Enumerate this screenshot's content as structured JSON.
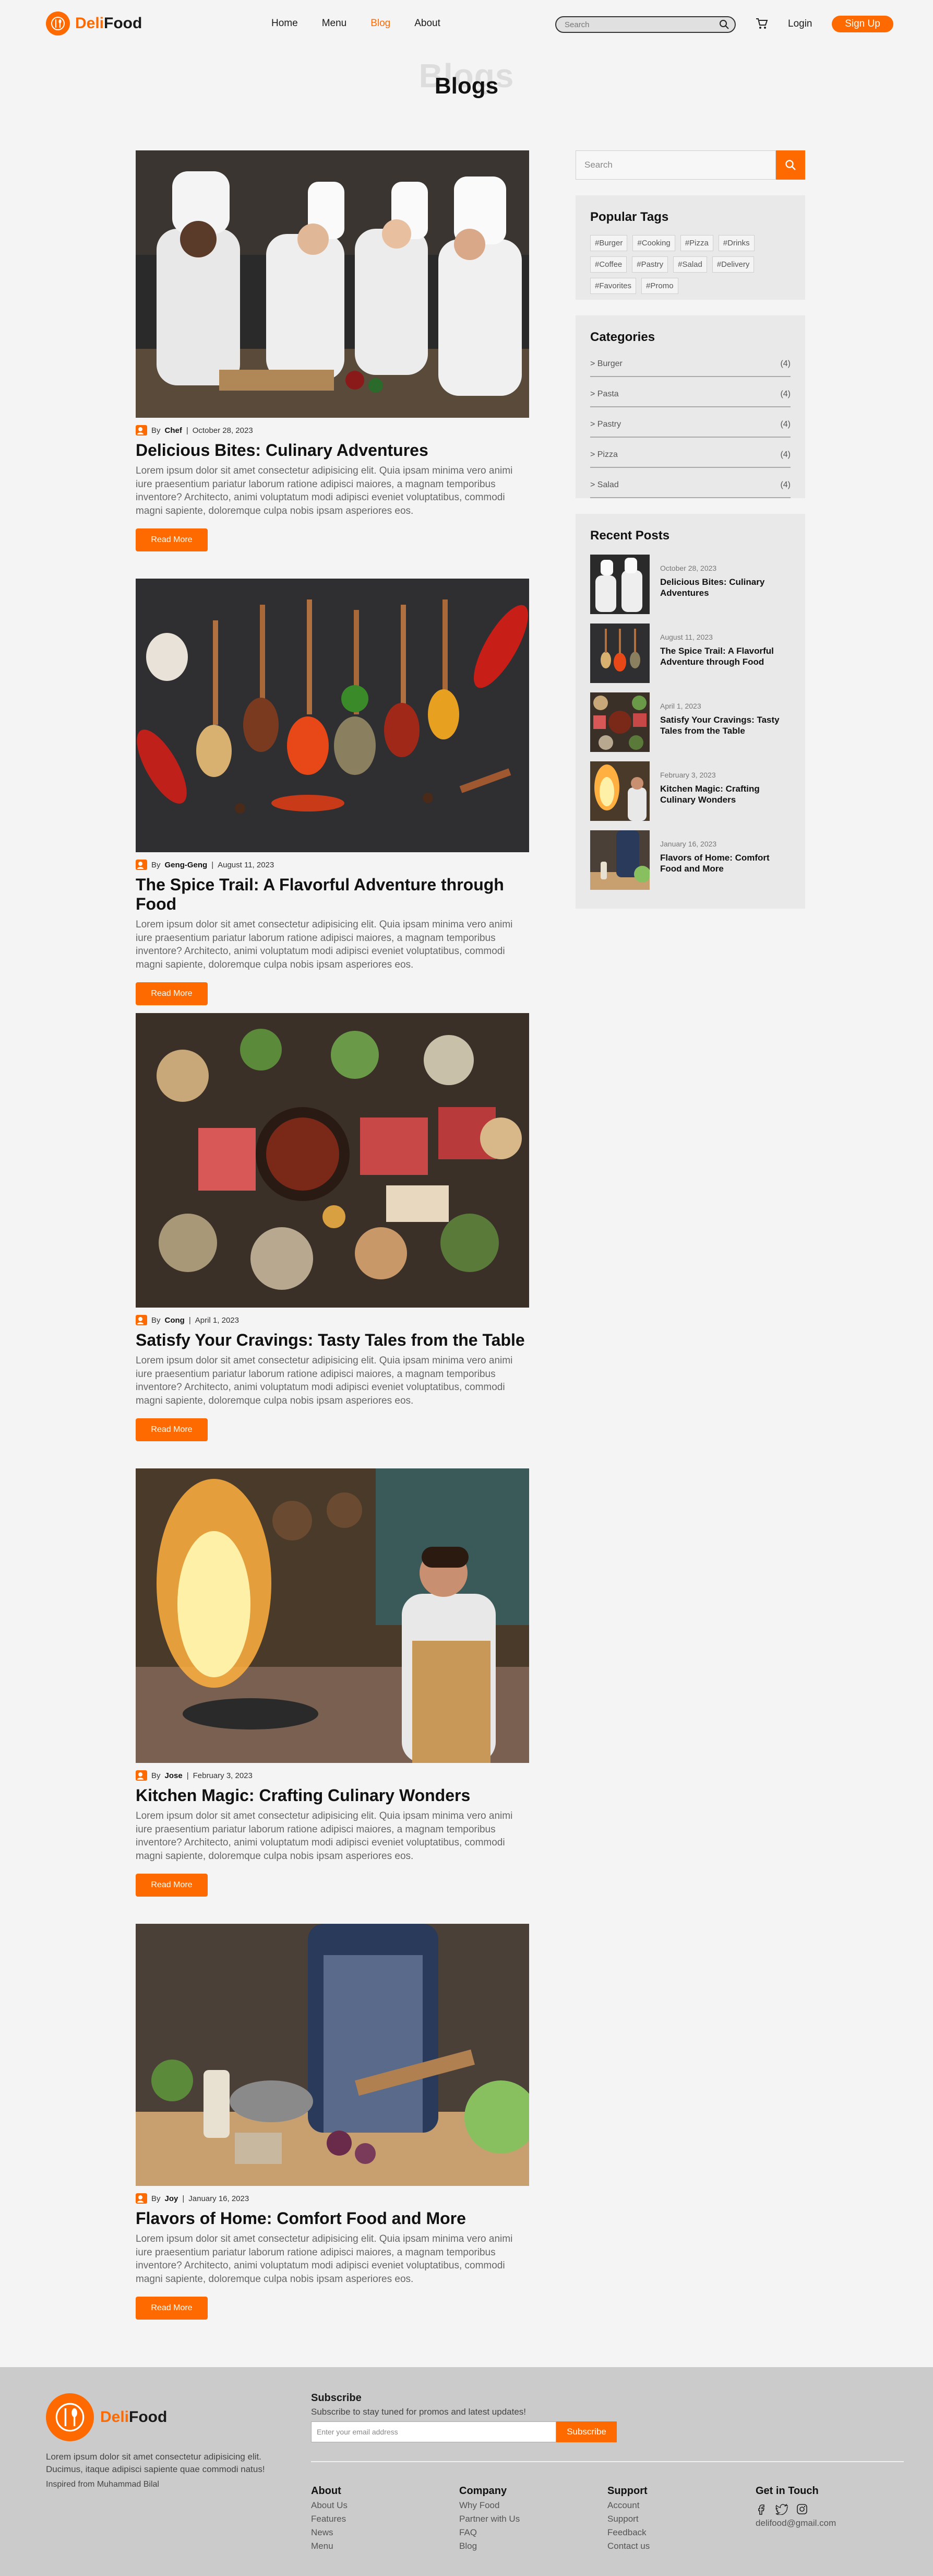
{
  "brand": {
    "name_part1": "Deli",
    "name_part2": "Food"
  },
  "nav": {
    "items": [
      "Home",
      "Menu",
      "Blog",
      "About"
    ],
    "active": "Blog"
  },
  "header": {
    "search_placeholder": "Search",
    "login": "Login",
    "signup": "Sign Up"
  },
  "page": {
    "ghost_title": "Blogs",
    "title": "Blogs"
  },
  "posts": [
    {
      "author_prefix": "By",
      "author": "Chef",
      "date": "October 28, 2023",
      "title": "Delicious Bites: Culinary Adventures",
      "body": "Lorem ipsum dolor sit amet consectetur adipisicing elit. Quia ipsam minima vero animi iure praesentium pariatur laborum ratione adipisci maiores, a magnam temporibus inventore? Architecto, animi voluptatum modi adipisci eveniet voluptatibus, commodi magni sapiente, doloremque culpa nobis ipsam asperiores eos.",
      "cta": "Read More"
    },
    {
      "author_prefix": "By",
      "author": "Geng-Geng",
      "date": "August 11, 2023",
      "title": "The Spice Trail: A Flavorful Adventure through Food",
      "body": "Lorem ipsum dolor sit amet consectetur adipisicing elit. Quia ipsam minima vero animi iure praesentium pariatur laborum ratione adipisci maiores, a magnam temporibus inventore? Architecto, animi voluptatum modi adipisci eveniet voluptatibus, commodi magni sapiente, doloremque culpa nobis ipsam asperiores eos.",
      "cta": "Read More"
    },
    {
      "author_prefix": "By",
      "author": "Cong",
      "date": "April 1, 2023",
      "title": "Satisfy Your Cravings: Tasty Tales from the Table",
      "body": "Lorem ipsum dolor sit amet consectetur adipisicing elit. Quia ipsam minima vero animi iure praesentium pariatur laborum ratione adipisci maiores, a magnam temporibus inventore? Architecto, animi voluptatum modi adipisci eveniet voluptatibus, commodi magni sapiente, doloremque culpa nobis ipsam asperiores eos.",
      "cta": "Read More"
    },
    {
      "author_prefix": "By",
      "author": "Jose",
      "date": "February 3, 2023",
      "title": "Kitchen Magic: Crafting Culinary Wonders",
      "body": "Lorem ipsum dolor sit amet consectetur adipisicing elit. Quia ipsam minima vero animi iure praesentium pariatur laborum ratione adipisci maiores, a magnam temporibus inventore? Architecto, animi voluptatum modi adipisci eveniet voluptatibus, commodi magni sapiente, doloremque culpa nobis ipsam asperiores eos.",
      "cta": "Read More"
    },
    {
      "author_prefix": "By",
      "author": "Joy",
      "date": "January 16, 2023",
      "title": "Flavors of Home: Comfort Food and More",
      "body": "Lorem ipsum dolor sit amet consectetur adipisicing elit. Quia ipsam minima vero animi iure praesentium pariatur laborum ratione adipisci maiores, a magnam temporibus inventore? Architecto, animi voluptatum modi adipisci eveniet voluptatibus, commodi magni sapiente, doloremque culpa nobis ipsam asperiores eos.",
      "cta": "Read More"
    }
  ],
  "sidebar": {
    "search_placeholder": "Search",
    "tags_title": "Popular Tags",
    "tags": [
      "#Burger",
      "#Cooking",
      "#Pizza",
      "#Drinks",
      "#Coffee",
      "#Pastry",
      "#Salad",
      "#Delivery",
      "#Favorites",
      "#Promo"
    ],
    "categories_title": "Categories",
    "categories": [
      {
        "name": "> Burger",
        "count": "(4)"
      },
      {
        "name": "> Pasta",
        "count": "(4)"
      },
      {
        "name": "> Pastry",
        "count": "(4)"
      },
      {
        "name": "> Pizza",
        "count": "(4)"
      },
      {
        "name": "> Salad",
        "count": "(4)"
      }
    ],
    "recent_title": "Recent Posts",
    "recent": [
      {
        "date": "October 28, 2023",
        "title": "Delicious Bites: Culinary Adventures"
      },
      {
        "date": "August 11, 2023",
        "title": "The Spice Trail: A Flavorful Adventure through Food"
      },
      {
        "date": "April 1, 2023",
        "title": "Satisfy Your Cravings: Tasty Tales from the Table"
      },
      {
        "date": "February 3, 2023",
        "title": "Kitchen Magic: Crafting Culinary Wonders"
      },
      {
        "date": "January 16, 2023",
        "title": "Flavors of Home: Comfort Food and More"
      }
    ]
  },
  "footer": {
    "description": "Lorem ipsum dolor sit amet consectetur adipisicing elit. Ducimus, itaque adipisci sapiente quae commodi natus!",
    "inspired": "Inspired from Muhammad Bilal",
    "subscribe_title": "Subscribe",
    "subscribe_text": "Subscribe to stay tuned for promos and latest updates!",
    "email_placeholder": "Enter your email address",
    "subscribe_button": "Subscribe",
    "columns": [
      {
        "title": "About",
        "items": [
          "About Us",
          "Features",
          "News",
          "Menu"
        ]
      },
      {
        "title": "Company",
        "items": [
          "Why Food",
          "Partner with Us",
          "FAQ",
          "Blog"
        ]
      },
      {
        "title": "Support",
        "items": [
          "Account",
          "Support",
          "Feedback",
          "Contact us"
        ]
      },
      {
        "title": "Get in Touch",
        "items": [
          "delifood@gmail.com"
        ]
      }
    ]
  },
  "colors": {
    "accent": "#ff6a00",
    "page_bg": "#f4f4f4",
    "panel_bg": "#e9e9e9",
    "footer_bg": "#cbcbcb"
  }
}
